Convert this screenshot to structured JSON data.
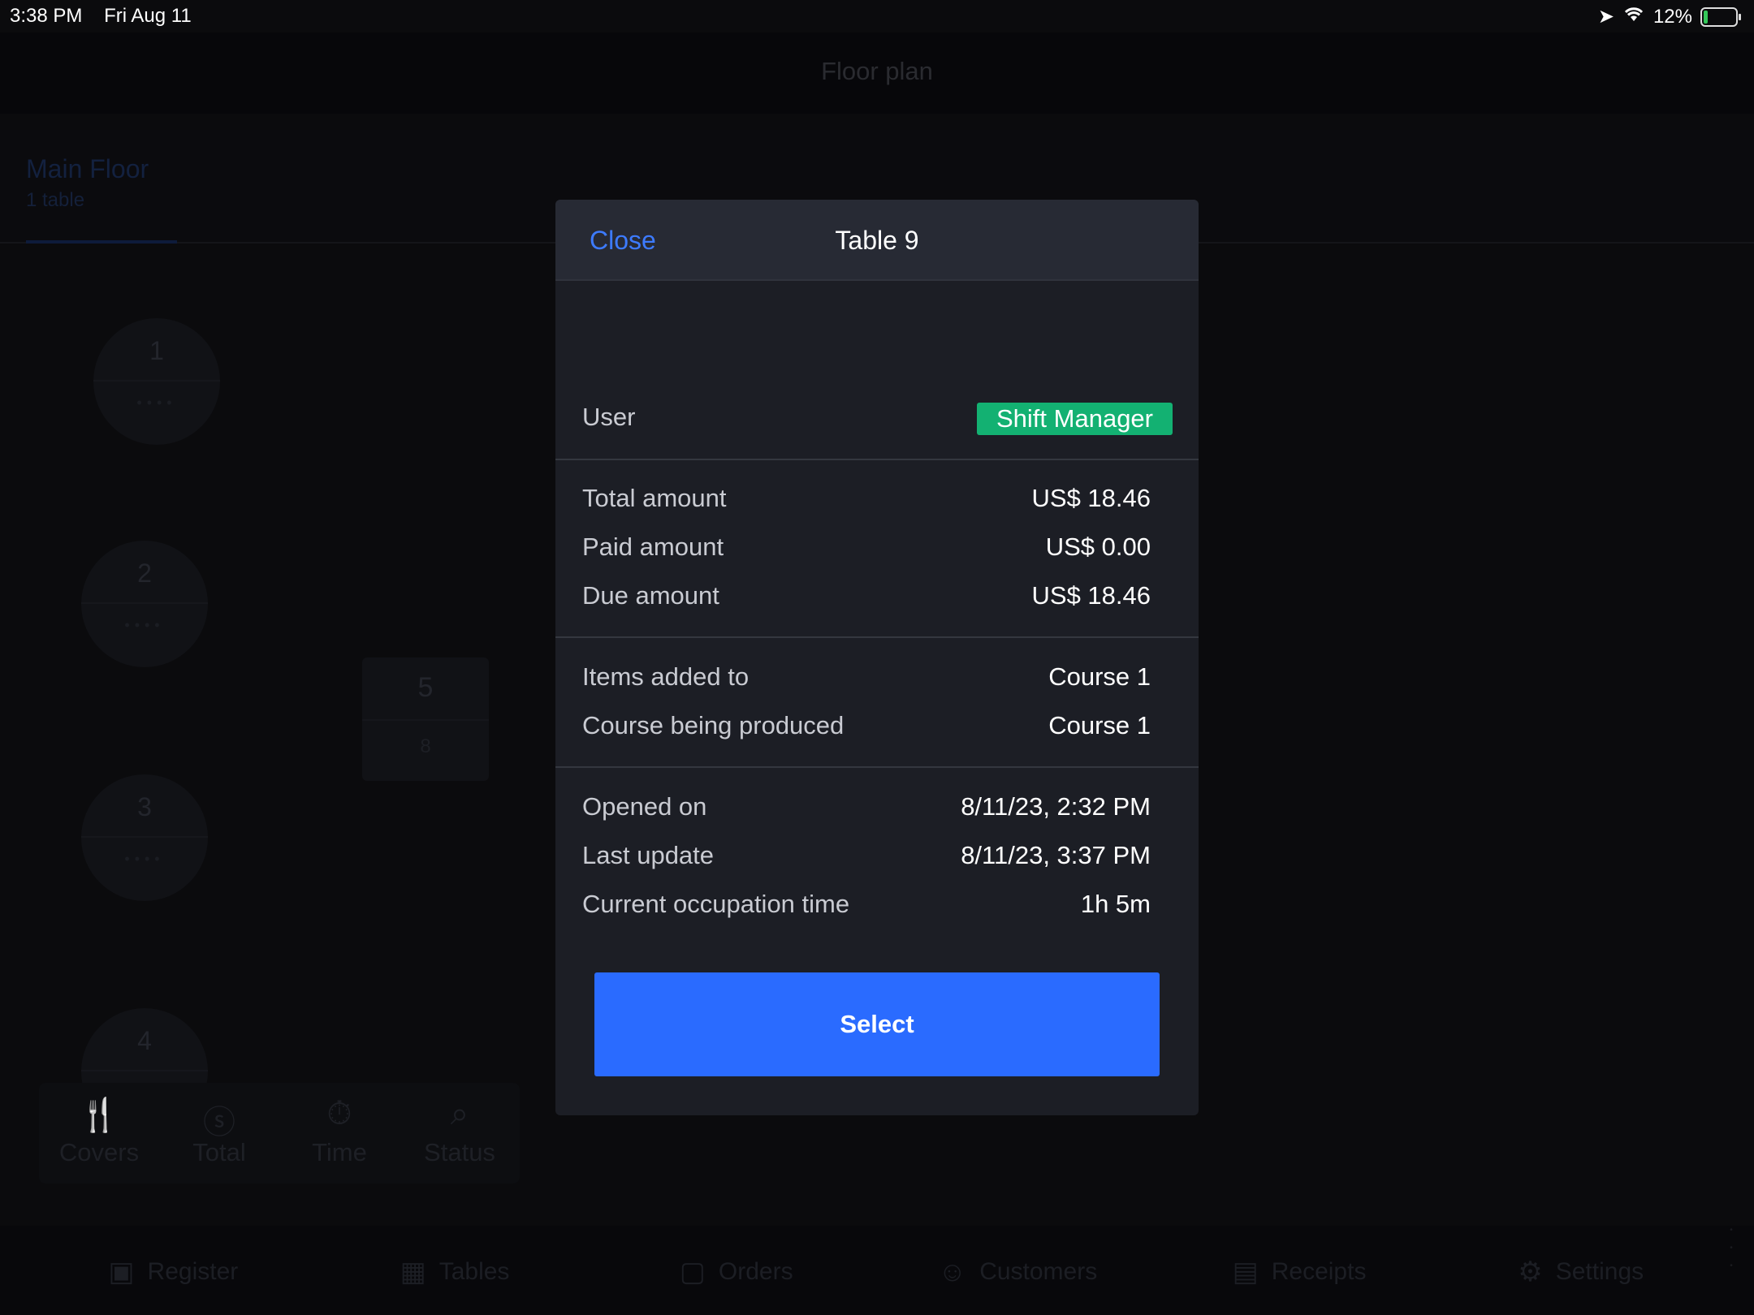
{
  "status_bar": {
    "time": "3:38 PM",
    "date": "Fri Aug 11",
    "battery": "12%",
    "battery_level": 0.12
  },
  "nav": {
    "title": "Floor plan"
  },
  "floor": {
    "name": "Main Floor",
    "count": "1 table"
  },
  "tables": [
    {
      "number": "1",
      "seats": "••••"
    },
    {
      "number": "2",
      "seats": "••••"
    },
    {
      "number": "3",
      "seats": "••••"
    },
    {
      "number": "4",
      "seats": ""
    },
    {
      "number": "5",
      "sub": "8"
    }
  ],
  "filters": [
    {
      "icon": "fork-knife-icon",
      "label": "Covers"
    },
    {
      "icon": "dollar-circle-icon",
      "label": "Total"
    },
    {
      "icon": "stopwatch-icon",
      "label": "Time"
    },
    {
      "icon": "search-icon",
      "label": "Status"
    }
  ],
  "tabbar": [
    {
      "icon": "register-icon",
      "label": "Register"
    },
    {
      "icon": "tables-icon",
      "label": "Tables"
    },
    {
      "icon": "bag-icon",
      "label": "Orders"
    },
    {
      "icon": "person-icon",
      "label": "Customers"
    },
    {
      "icon": "receipt-icon",
      "label": "Receipts"
    },
    {
      "icon": "gear-icon",
      "label": "Settings"
    }
  ],
  "modal": {
    "close_label": "Close",
    "title": "Table 9",
    "user_label": "User",
    "user_value": "Shift Manager",
    "user_badge_color": "#13b172",
    "amounts": [
      {
        "label": "Total amount",
        "value": "US$ 18.46"
      },
      {
        "label": "Paid amount",
        "value": "US$ 0.00"
      },
      {
        "label": "Due amount",
        "value": "US$ 18.46"
      }
    ],
    "courses": [
      {
        "label": "Items added to",
        "value": "Course 1"
      },
      {
        "label": "Course being produced",
        "value": "Course 1"
      }
    ],
    "times": [
      {
        "label": "Opened on",
        "value": "8/11/23, 2:32 PM"
      },
      {
        "label": "Last update",
        "value": "8/11/23, 3:37 PM"
      },
      {
        "label": "Current occupation time",
        "value": "1h 5m"
      }
    ],
    "select_label": "Select",
    "accent_color": "#2a6bff"
  }
}
